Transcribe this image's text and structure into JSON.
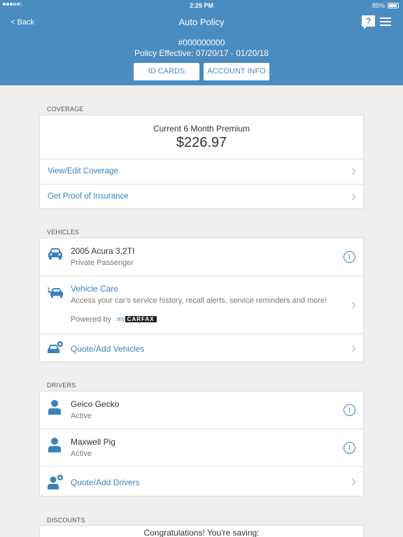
{
  "status_bar": {
    "time": "2:29 PM",
    "battery": "85%"
  },
  "header": {
    "back_label": "< Back",
    "title": "Auto Policy",
    "help_label": "?",
    "policy_number": "#000000000",
    "policy_effective": "Policy Effective: 07/20/17 - 01/20/18",
    "id_cards_label": "ID CARDS",
    "account_info_label": "ACCOUNT INFO"
  },
  "coverage": {
    "section_label": "COVERAGE",
    "premium_label": "Current 6 Month Premium",
    "premium_value": "$226.97",
    "links": [
      "View/Edit Coverage",
      "Get Proof of Insurance"
    ]
  },
  "vehicles": {
    "section_label": "VEHICLES",
    "vehicle": {
      "name": "2005 Acura 3.2TI",
      "type": "Private Passenger"
    },
    "vehicle_care": {
      "title": "Vehicle Care",
      "description": "Access your car's service history, recall alerts, service reminders and more!",
      "powered_by": "Powered by",
      "brand_my": "my",
      "brand_name": "CARFAX"
    },
    "add_label": "Quote/Add Vehicles"
  },
  "drivers": {
    "section_label": "DRIVERS",
    "list": [
      {
        "name": "Geico Gecko",
        "status": "Active"
      },
      {
        "name": "Maxwell Pig",
        "status": "Active"
      }
    ],
    "add_label": "Quote/Add Drivers"
  },
  "discounts": {
    "section_label": "DISCOUNTS",
    "message": "Congratulations! You're saving:"
  },
  "colors": {
    "primary": "#4a8cc0",
    "link": "#3b82bd",
    "background": "#efefef"
  },
  "icons": [
    "car-icon",
    "vehicle-care-icon",
    "add-vehicle-icon",
    "person-icon",
    "add-person-icon",
    "info-icon",
    "chevron-right-icon",
    "menu-icon",
    "help-icon"
  ]
}
